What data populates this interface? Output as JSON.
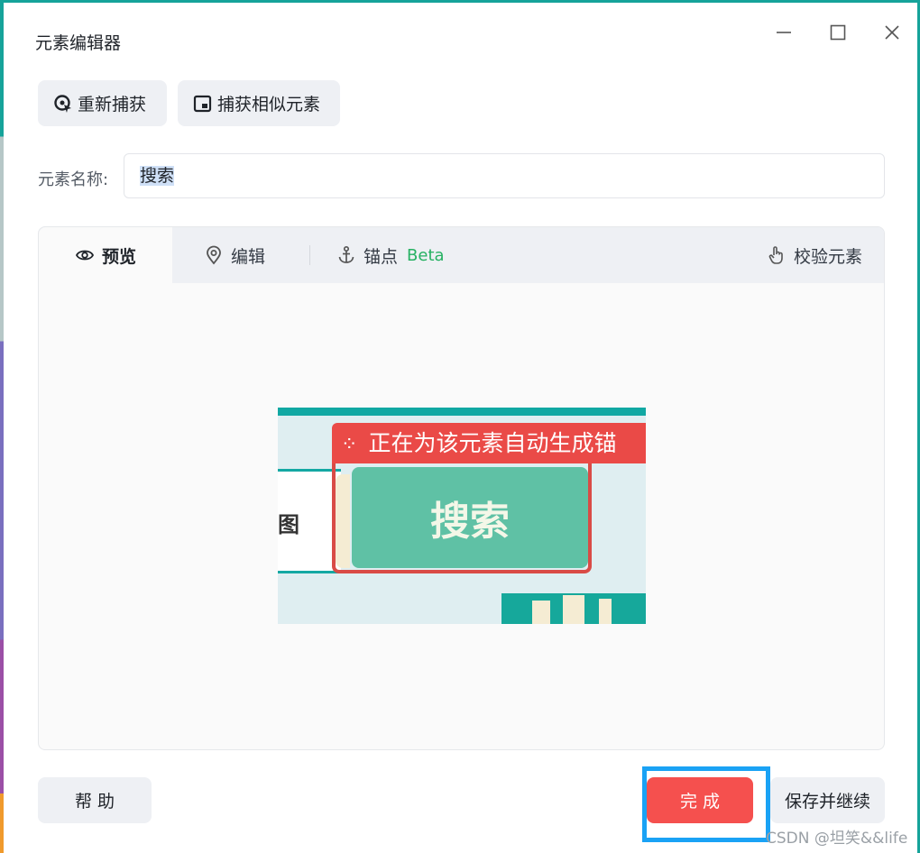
{
  "window": {
    "title": "元素编辑器"
  },
  "toolbar": {
    "recapture_label": "重新捕获",
    "capture_similar_label": "捕获相似元素"
  },
  "element_name": {
    "label": "元素名称:",
    "value": "搜索"
  },
  "tabs": [
    {
      "label": "预览",
      "icon": "eye-icon",
      "active": true
    },
    {
      "label": "编辑",
      "icon": "location-pin-icon",
      "active": false
    },
    {
      "label": "锚点",
      "icon": "anchor-icon",
      "badge": "Beta",
      "active": false
    }
  ],
  "verify": {
    "label": "校验元素",
    "icon": "hand-pointer-icon"
  },
  "preview": {
    "badge_text": "正在为该元素自动生成锚",
    "button_text": "搜索",
    "left_char": "图"
  },
  "footer": {
    "help_label": "帮 助",
    "done_label": "完 成",
    "save_continue_label": "保存并继续"
  },
  "watermark": "CSDN @坦笑&&life",
  "colors": {
    "accent_teal": "#16a39a",
    "done_red": "#f5504e",
    "focus_blue": "#1aa2f5",
    "beta_green": "#27b163"
  }
}
